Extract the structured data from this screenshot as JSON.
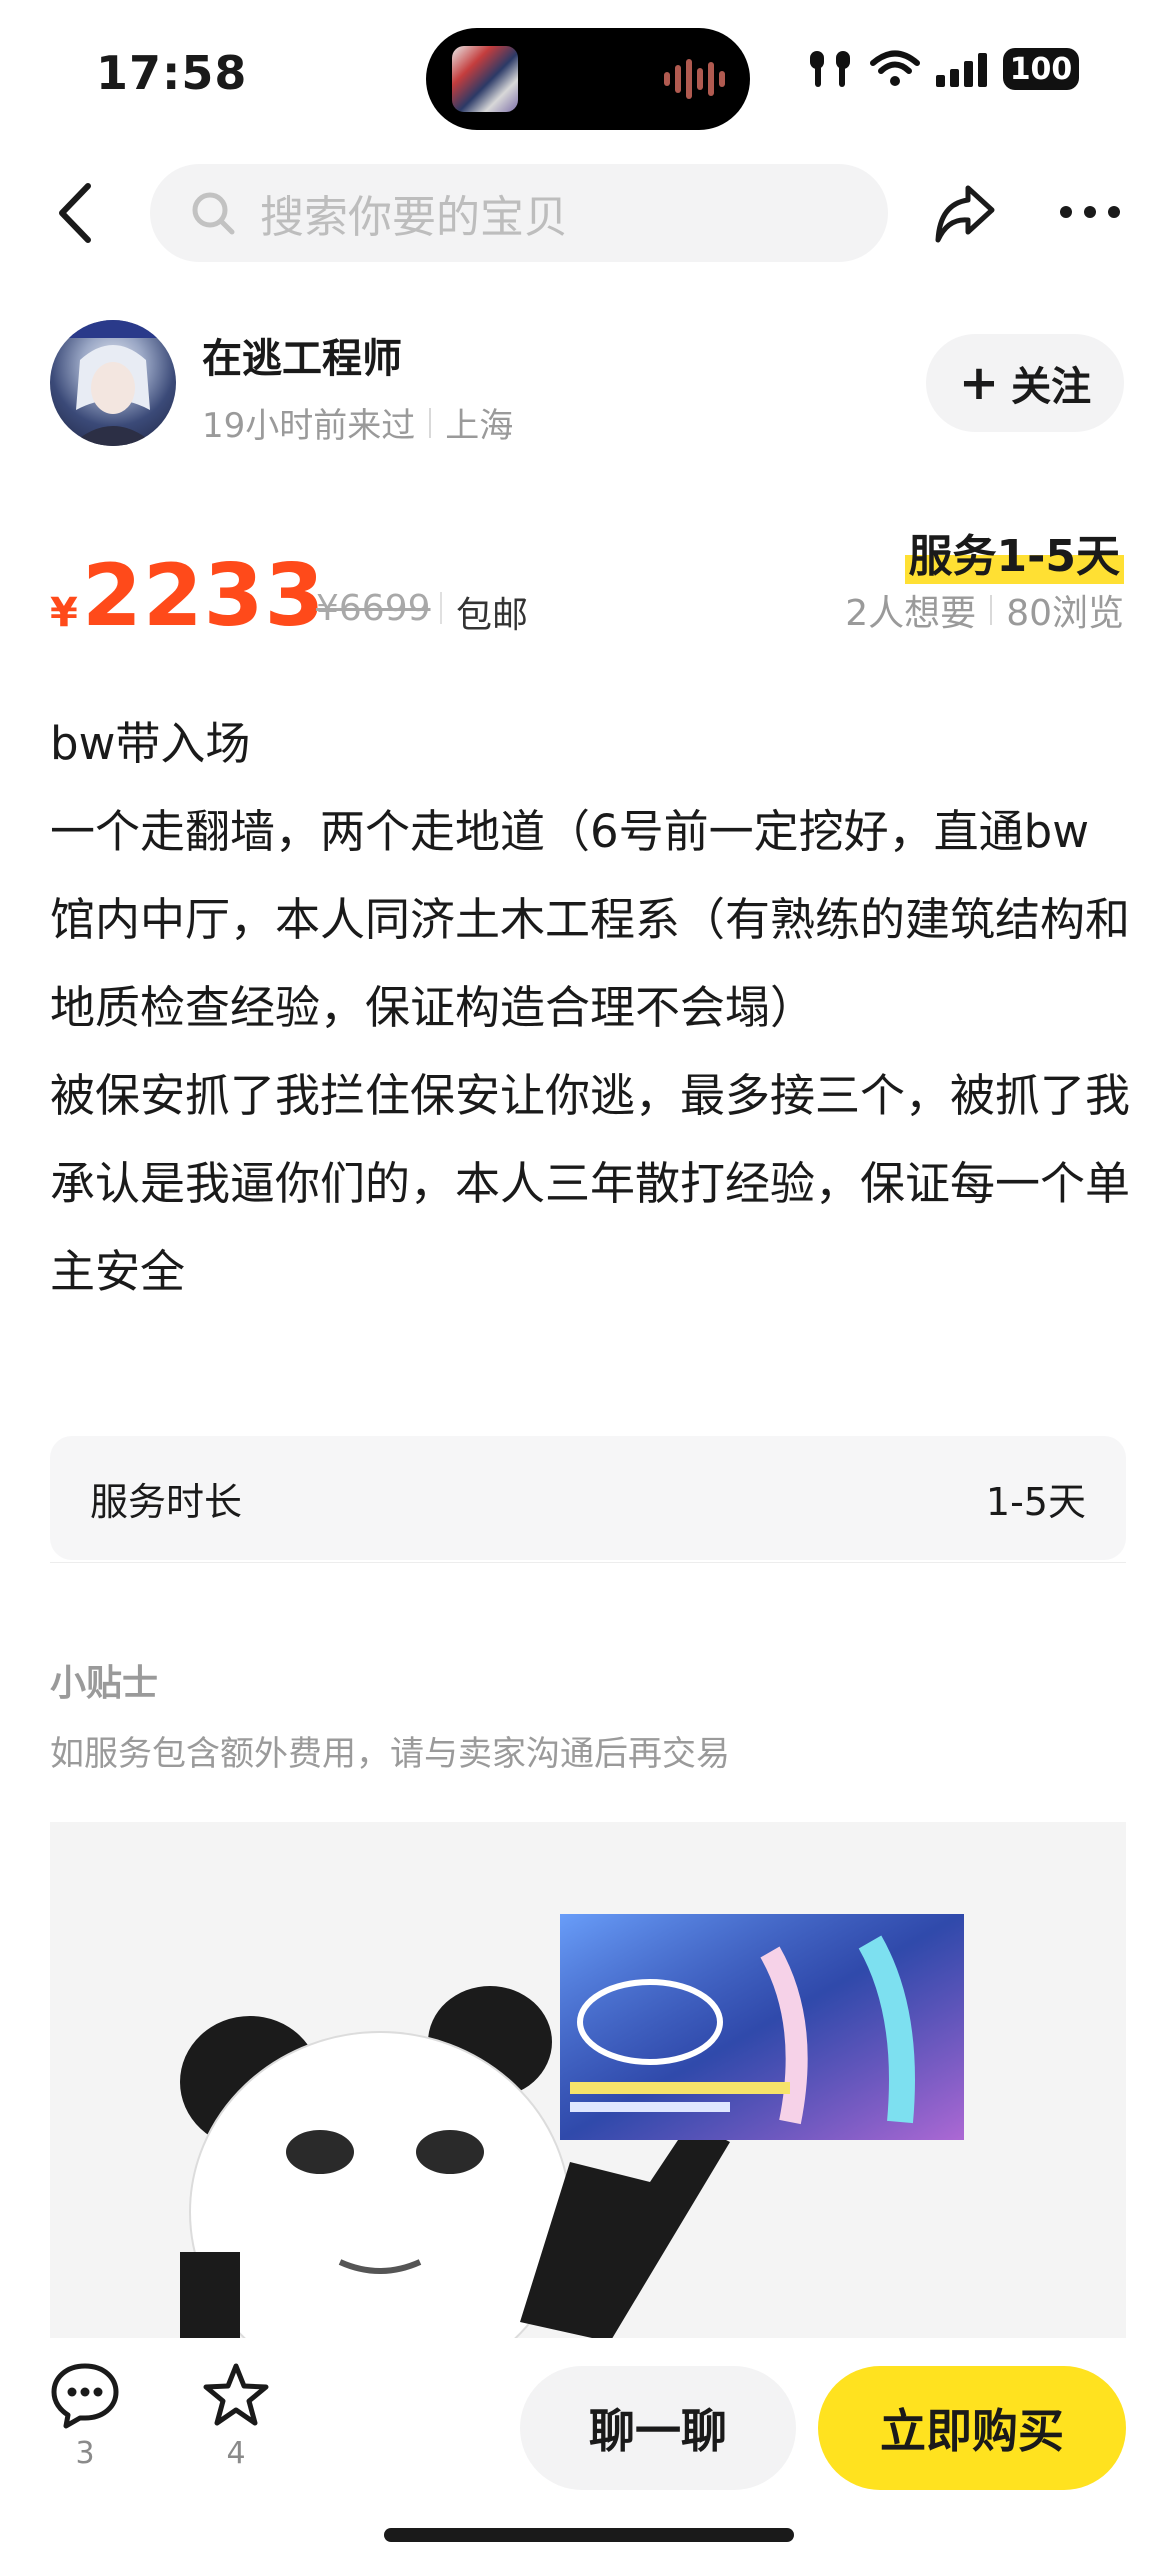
{
  "status_bar": {
    "time": "17:58",
    "battery": "100"
  },
  "nav": {
    "search_placeholder": "搜索你要的宝贝",
    "icons": [
      "back-arrow-icon",
      "search-icon",
      "share-icon",
      "more-icon"
    ]
  },
  "seller": {
    "name": "在逃工程师",
    "last_seen": "19小时前来过",
    "location": "上海",
    "follow_label": "关注"
  },
  "price": {
    "currency": "¥",
    "current": "2233",
    "original": "¥6699",
    "shipping": "包邮",
    "service_tag": "服务1-5天",
    "wants": "2人想要",
    "views": "80浏览"
  },
  "description": {
    "lines": [
      "bw带入场",
      "一个走翻墙，两个走地道（6号前一定挖好，直通bw馆内中厅，本人同济土木工程系（有熟练的建筑结构和地质检查经验，保证构造合理不会塌）",
      "被保安抓了我拦住保安让你逃，最多接三个，被抓了我承认是我逼你们的，本人三年散打经验，保证每一个单主安全"
    ]
  },
  "duration": {
    "label": "服务时长",
    "value": "1-5天"
  },
  "tips": {
    "title": "小贴士",
    "text": "如服务包含额外费用，请与卖家沟通后再交易"
  },
  "bottom_bar": {
    "comments_count": "3",
    "favorites_count": "4",
    "chat_label": "聊一聊",
    "buy_label": "立即购买"
  },
  "colors": {
    "price": "#ff4a1a",
    "accent_yellow": "#ffe21f",
    "muted_text": "#9a9a9a"
  }
}
